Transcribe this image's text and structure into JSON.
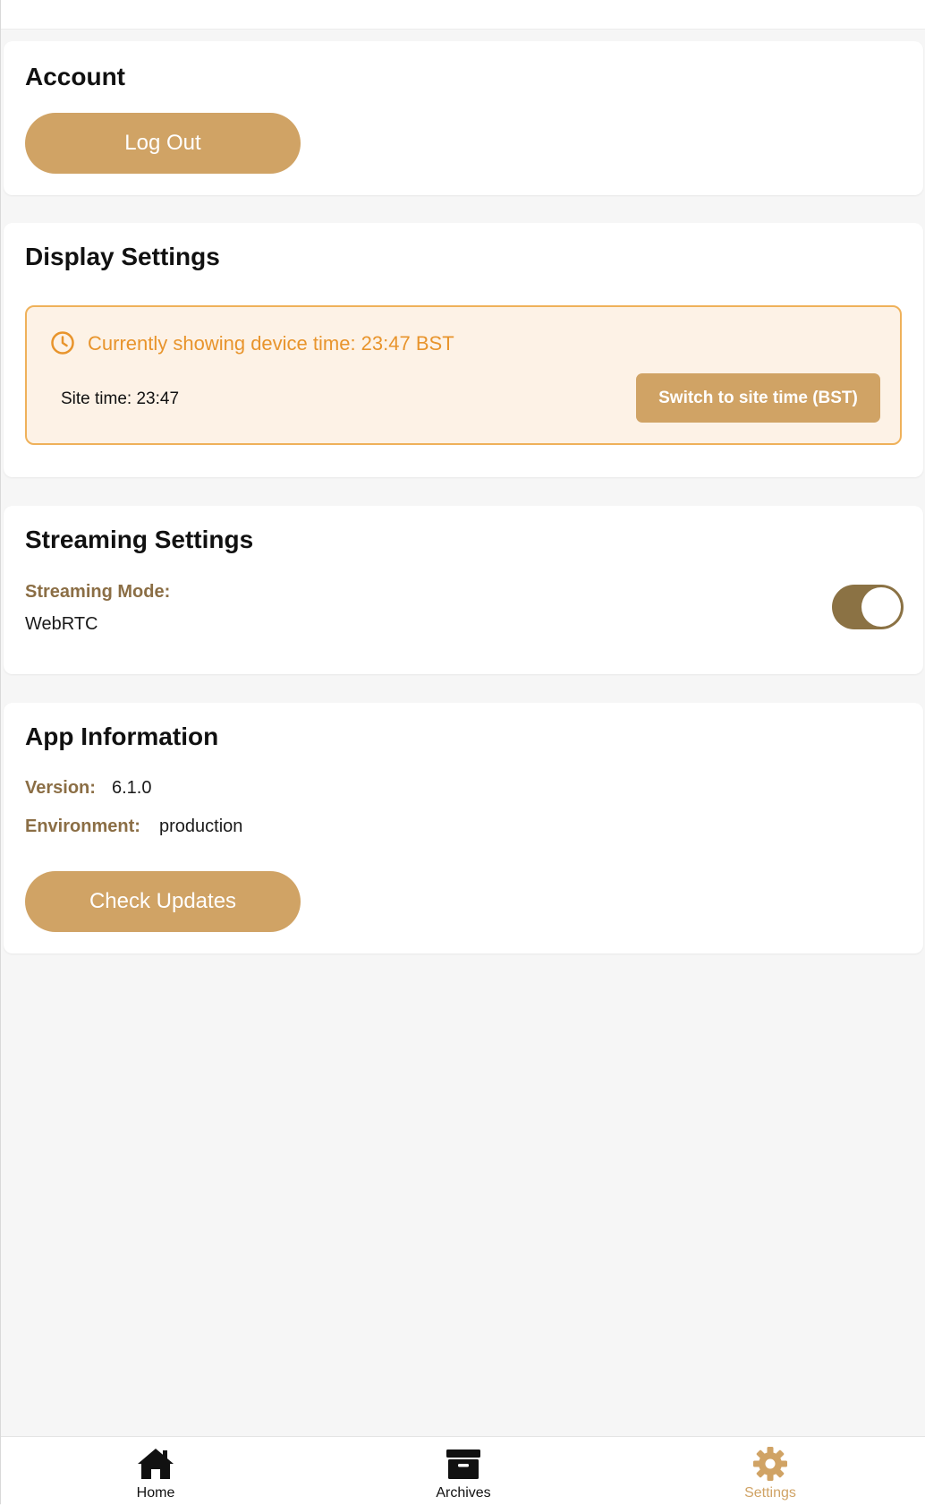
{
  "colors": {
    "accent": "#d0a365",
    "accent_dark": "#8b7244",
    "warning_text": "#e8942c",
    "warning_bg": "#fdf2e6",
    "warning_border": "#efb15a",
    "label": "#8b6e45",
    "tab_inactive": "#111111",
    "background": "#f6f6f6"
  },
  "account": {
    "title": "Account",
    "logout_label": "Log Out"
  },
  "display_settings": {
    "title": "Display Settings",
    "clock_icon": "clock-icon",
    "device_time_text": "Currently showing device time: 23:47 BST",
    "site_time_text": "Site time: 23:47",
    "switch_label": "Switch to site time (BST)"
  },
  "streaming_settings": {
    "title": "Streaming Settings",
    "mode_label": "Streaming Mode:",
    "mode_value": "WebRTC",
    "toggle_on": true
  },
  "app_information": {
    "title": "App Information",
    "version_label": "Version:",
    "version_value": "6.1.0",
    "environment_label": "Environment:",
    "environment_value": "production",
    "check_updates_label": "Check Updates"
  },
  "tabbar": {
    "tabs": [
      {
        "label": "Home",
        "icon": "home-icon",
        "active": false
      },
      {
        "label": "Archives",
        "icon": "archive-box-icon",
        "active": false
      },
      {
        "label": "Settings",
        "icon": "gear-icon",
        "active": true
      }
    ]
  }
}
